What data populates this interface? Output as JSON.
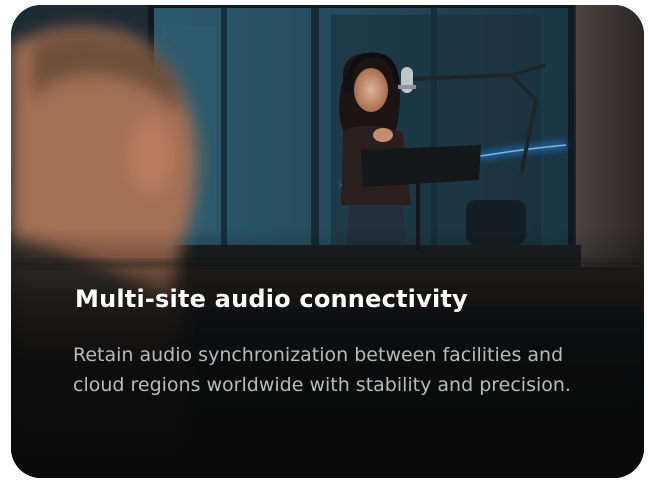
{
  "card": {
    "title": "Multi-site audio connectivity",
    "description": "Retain audio synchronization between facilities and cloud regions worldwide with stability and precision.",
    "image": "photo of singer in recording booth behind glass, blurred person in foreground"
  },
  "colors": {
    "card_background": "#0b0d10",
    "title": "#ffffff",
    "description": "#b8babd",
    "accent_blue": "#2a7fd4"
  }
}
